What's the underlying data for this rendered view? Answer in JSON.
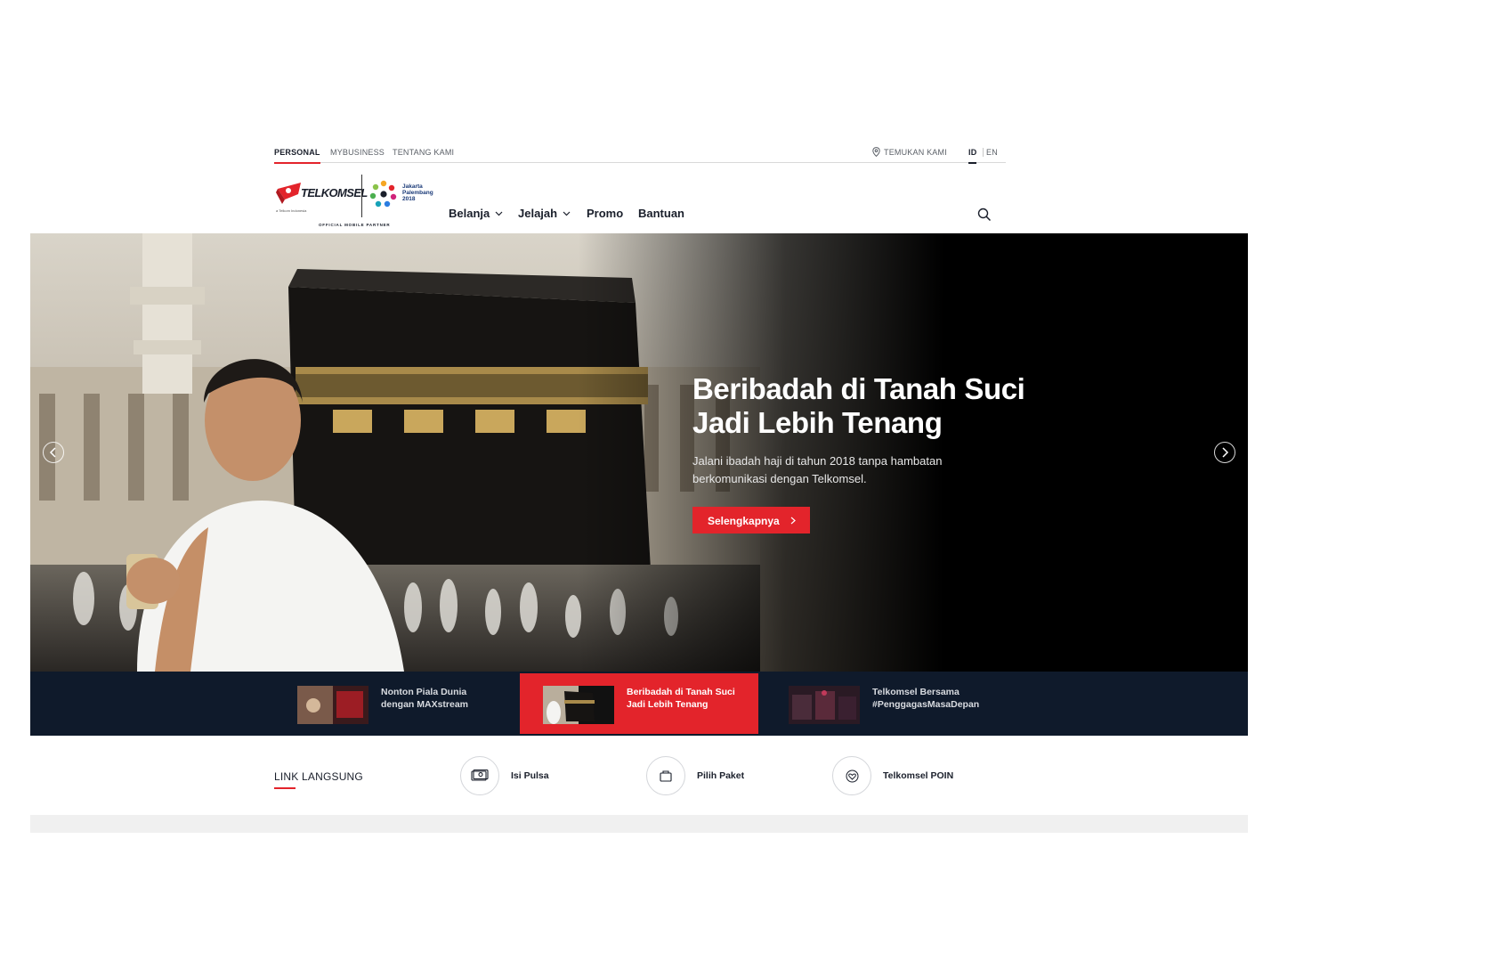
{
  "topbar": {
    "left_links": [
      "PERSONAL",
      "MYBUSINESS",
      "TENTANG KAMI"
    ],
    "find_us": "TEMUKAN KAMI",
    "lang_active": "ID",
    "lang_other": "EN"
  },
  "brand": {
    "name": "TELKOMSEL",
    "parent": "a Telkom Indonesia",
    "event_line1": "Jakarta",
    "event_line2": "Palembang",
    "event_year": "2018",
    "tagline": "OFFICIAL MOBILE PARTNER"
  },
  "nav": {
    "items": [
      "Belanja",
      "Jelajah",
      "Promo",
      "Bantuan"
    ]
  },
  "hero": {
    "title_line1": "Beribadah di Tanah Suci",
    "title_line2": "Jadi Lebih Tenang",
    "subtitle_line1": "Jalani ibadah haji di tahun 2018 tanpa hambatan",
    "subtitle_line2": "berkomunikasi dengan Telkomsel.",
    "cta": "Selengkapnya"
  },
  "carousel": {
    "items": [
      {
        "line1": "Nonton Piala Dunia",
        "line2": "dengan MAXstream",
        "active": false
      },
      {
        "line1": "Beribadah di Tanah Suci",
        "line2": "Jadi Lebih Tenang",
        "active": true
      },
      {
        "line1": "Telkomsel Bersama",
        "line2": "#PenggagasMasaDepan",
        "active": false
      }
    ]
  },
  "quick_links": {
    "label": "LINK LANGSUNG",
    "items": [
      {
        "label": "Isi Pulsa",
        "icon": "money-icon"
      },
      {
        "label": "Pilih Paket",
        "icon": "package-icon"
      },
      {
        "label": "Telkomsel POIN",
        "icon": "heart-icon"
      }
    ]
  },
  "colors": {
    "accent": "#e3242b",
    "navy": "#0f1a2b",
    "text": "#1a1f2b"
  }
}
